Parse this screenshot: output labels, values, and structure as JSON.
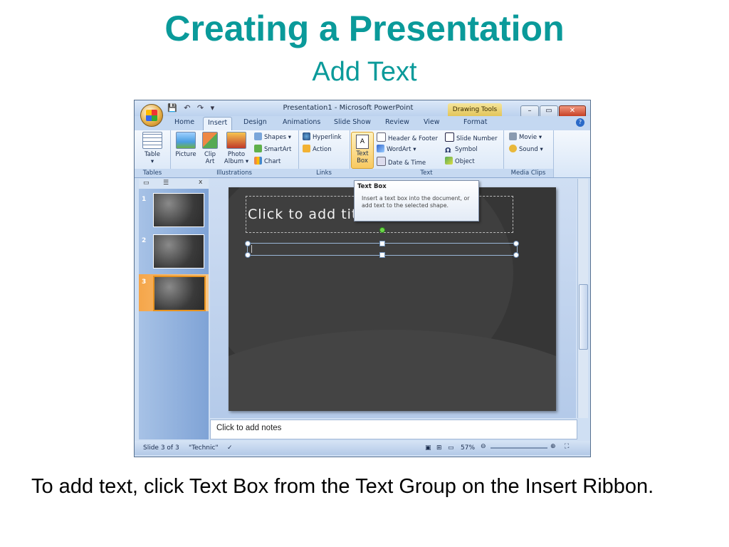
{
  "slide": {
    "title": "Creating a Presentation",
    "subtitle": "Add Text",
    "caption": "To add text, click Text Box from the Text Group on the Insert Ribbon."
  },
  "window": {
    "title": "Presentation1 - Microsoft PowerPoint",
    "contextual_tab": "Drawing Tools",
    "qat_icons": [
      "save-icon",
      "undo-icon",
      "redo-icon",
      "customize-icon"
    ],
    "minimize": "–",
    "maximize": "▭",
    "close": "✕"
  },
  "tabs": [
    "Home",
    "Insert",
    "Design",
    "Animations",
    "Slide Show",
    "Review",
    "View",
    "Format"
  ],
  "active_tab": "Insert",
  "ribbon": {
    "tables": {
      "label": "Tables",
      "table": "Table"
    },
    "illustrations": {
      "label": "Illustrations",
      "picture": "Picture",
      "clip_art_1": "Clip",
      "clip_art_2": "Art",
      "photo_album_1": "Photo",
      "photo_album_2": "Album ▾",
      "shapes": "Shapes ▾",
      "smartart": "SmartArt",
      "chart": "Chart"
    },
    "links": {
      "label": "Links",
      "hyperlink": "Hyperlink",
      "action": "Action"
    },
    "text": {
      "label": "Text",
      "text_box_1": "Text",
      "text_box_2": "Box",
      "header_footer": "Header & Footer",
      "wordart": "WordArt ▾",
      "date_time": "Date & Time",
      "slide_number": "Slide Number",
      "symbol": "Symbol",
      "object": "Object"
    },
    "media": {
      "label": "Media Clips",
      "movie": "Movie ▾",
      "sound": "Sound ▾"
    }
  },
  "tooltip": {
    "title": "Text Box",
    "body": "Insert a text box into the document, or add text to the selected shape."
  },
  "slides_pane": {
    "close": "x",
    "thumbnails": [
      {
        "num": "1"
      },
      {
        "num": "2"
      },
      {
        "num": "3"
      }
    ],
    "selected": "3"
  },
  "editor": {
    "title_placeholder": "Click to add title",
    "notes_placeholder": "Click to add notes"
  },
  "status": {
    "slide_info": "Slide 3 of 3",
    "theme": "\"Technic\"",
    "zoom": "57%"
  },
  "colors": {
    "heading": "#0a9a9a",
    "slide_bg": "#363636",
    "ribbon_bg": "#d8e6f7"
  }
}
